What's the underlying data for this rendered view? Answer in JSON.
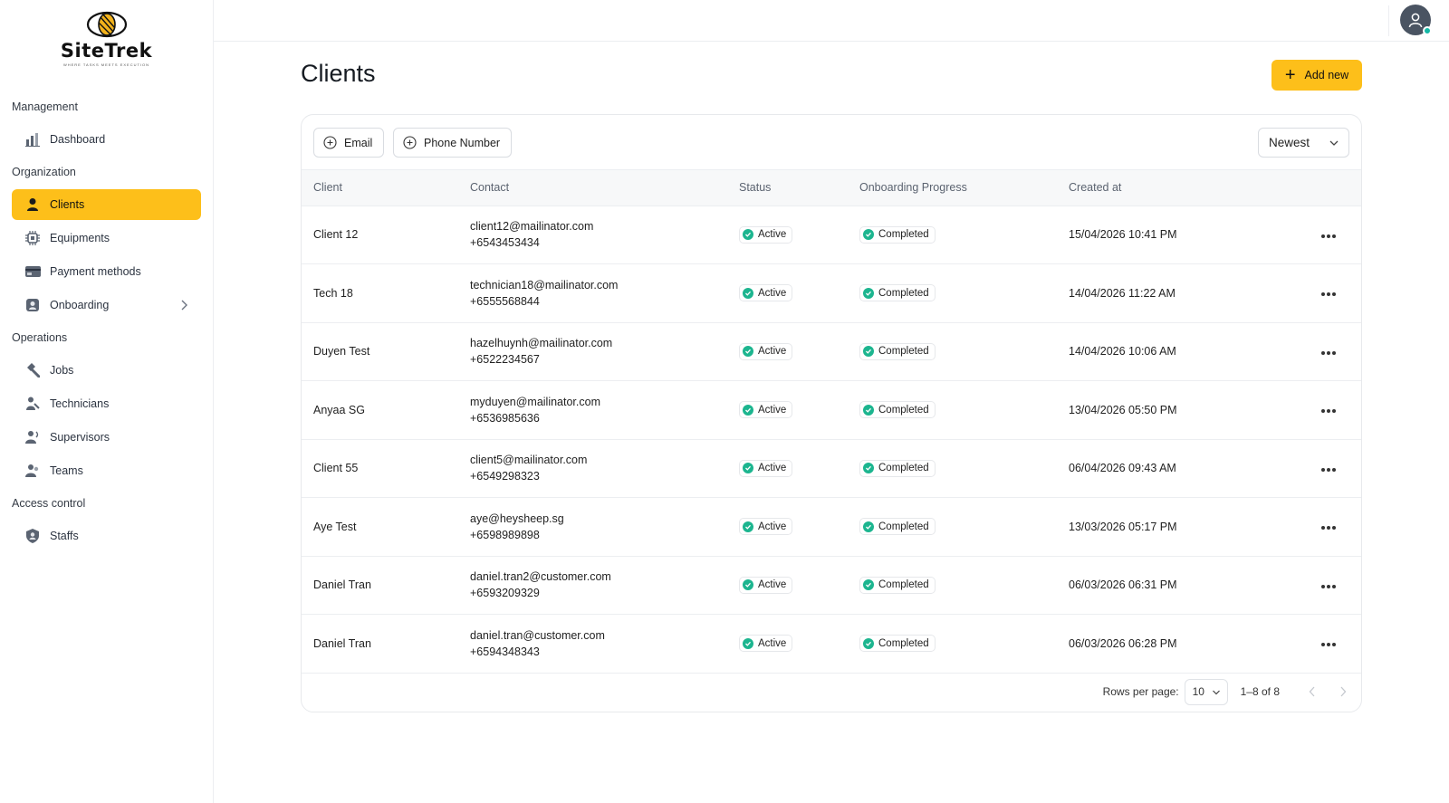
{
  "brand": {
    "name": "SiteTrek",
    "tagline": "WHERE TASKS MEETS EXECUTION"
  },
  "sidebar": {
    "sections": [
      {
        "label": "Management",
        "items": [
          {
            "label": "Dashboard",
            "icon": "bar-chart-icon"
          }
        ]
      },
      {
        "label": "Organization",
        "items": [
          {
            "label": "Clients",
            "icon": "person-icon",
            "active": true
          },
          {
            "label": "Equipments",
            "icon": "chip-icon"
          },
          {
            "label": "Payment methods",
            "icon": "credit-card-icon"
          },
          {
            "label": "Onboarding",
            "icon": "badge-icon",
            "chevron": true
          }
        ]
      },
      {
        "label": "Operations",
        "items": [
          {
            "label": "Jobs",
            "icon": "hammer-icon"
          },
          {
            "label": "Technicians",
            "icon": "technician-icon"
          },
          {
            "label": "Supervisors",
            "icon": "supervisor-icon"
          },
          {
            "label": "Teams",
            "icon": "team-icon"
          }
        ]
      },
      {
        "label": "Access control",
        "items": [
          {
            "label": "Staffs",
            "icon": "shield-user-icon"
          }
        ]
      }
    ]
  },
  "page": {
    "title": "Clients",
    "add_button": "Add new"
  },
  "filters": {
    "chips": [
      "Email",
      "Phone Number"
    ],
    "sort": "Newest"
  },
  "table": {
    "columns": [
      "Client",
      "Contact",
      "Status",
      "Onboarding Progress",
      "Created at"
    ],
    "rows": [
      {
        "client": "Client 12",
        "email": "client12@mailinator.com",
        "phone": "+6543453434",
        "status": "Active",
        "progress": "Completed",
        "created": "15/04/2026 10:41 PM"
      },
      {
        "client": "Tech 18",
        "email": "technician18@mailinator.com",
        "phone": "+6555568844",
        "status": "Active",
        "progress": "Completed",
        "created": "14/04/2026 11:22 AM"
      },
      {
        "client": "Duyen Test",
        "email": "hazelhuynh@mailinator.com",
        "phone": "+6522234567",
        "status": "Active",
        "progress": "Completed",
        "created": "14/04/2026 10:06 AM"
      },
      {
        "client": "Anyaa SG",
        "email": "myduyen@mailinator.com",
        "phone": "+6536985636",
        "status": "Active",
        "progress": "Completed",
        "created": "13/04/2026 05:50 PM"
      },
      {
        "client": "Client 55",
        "email": "client5@mailinator.com",
        "phone": "+6549298323",
        "status": "Active",
        "progress": "Completed",
        "created": "06/04/2026 09:43 AM"
      },
      {
        "client": "Aye Test",
        "email": "aye@heysheep.sg",
        "phone": "+6598989898",
        "status": "Active",
        "progress": "Completed",
        "created": "13/03/2026 05:17 PM"
      },
      {
        "client": "Daniel Tran",
        "email": "daniel.tran2@customer.com",
        "phone": "+6593209329",
        "status": "Active",
        "progress": "Completed",
        "created": "06/03/2026 06:31 PM"
      },
      {
        "client": "Daniel Tran",
        "email": "daniel.tran@customer.com",
        "phone": "+6594348343",
        "status": "Active",
        "progress": "Completed",
        "created": "06/03/2026 06:28 PM"
      }
    ]
  },
  "pagination": {
    "rows_label": "Rows per page:",
    "rows_value": "10",
    "range": "1–8 of 8"
  },
  "colors": {
    "accent": "#fdbf1a",
    "success": "#1cb58f",
    "online": "#14b8a6"
  }
}
